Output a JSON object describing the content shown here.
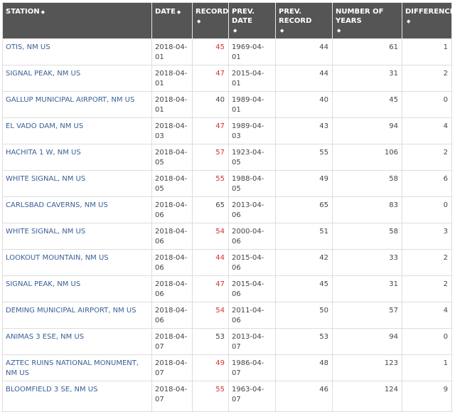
{
  "columns": [
    {
      "label": "STATION"
    },
    {
      "label": "DATE"
    },
    {
      "label": "RECORD"
    },
    {
      "label": "PREV. DATE"
    },
    {
      "label": "PREV. RECORD"
    },
    {
      "label": "NUMBER OF YEARS"
    },
    {
      "label": "DIFFERENCE"
    }
  ],
  "sort_icon": "sort-arrows-icon",
  "sort_glyph": "◆",
  "colors": {
    "header_bg": "#555555",
    "link": "#3a5f95",
    "record_hot": "#d0342c"
  },
  "rows": [
    {
      "station": "OTIS, NM US",
      "date": "2018-04-01",
      "record": "45",
      "prev_date": "1969-04-01",
      "prev_record": "44",
      "years": "61",
      "difference": "1",
      "hot": true
    },
    {
      "station": "SIGNAL PEAK, NM US",
      "date": "2018-04-01",
      "record": "47",
      "prev_date": "2015-04-01",
      "prev_record": "44",
      "years": "31",
      "difference": "2",
      "hot": true
    },
    {
      "station": "GALLUP MUNICIPAL AIRPORT, NM US",
      "date": "2018-04-01",
      "record": "40",
      "prev_date": "1989-04-01",
      "prev_record": "40",
      "years": "45",
      "difference": "0",
      "hot": false
    },
    {
      "station": "EL VADO DAM, NM US",
      "date": "2018-04-03",
      "record": "47",
      "prev_date": "1989-04-03",
      "prev_record": "43",
      "years": "94",
      "difference": "4",
      "hot": true
    },
    {
      "station": "HACHITA 1 W, NM US",
      "date": "2018-04-05",
      "record": "57",
      "prev_date": "1923-04-05",
      "prev_record": "55",
      "years": "106",
      "difference": "2",
      "hot": true
    },
    {
      "station": "WHITE SIGNAL, NM US",
      "date": "2018-04-05",
      "record": "55",
      "prev_date": "1988-04-05",
      "prev_record": "49",
      "years": "58",
      "difference": "6",
      "hot": true
    },
    {
      "station": "CARLSBAD CAVERNS, NM US",
      "date": "2018-04-06",
      "record": "65",
      "prev_date": "2013-04-06",
      "prev_record": "65",
      "years": "83",
      "difference": "0",
      "hot": false
    },
    {
      "station": "WHITE SIGNAL, NM US",
      "date": "2018-04-06",
      "record": "54",
      "prev_date": "2000-04-06",
      "prev_record": "51",
      "years": "58",
      "difference": "3",
      "hot": true
    },
    {
      "station": "LOOKOUT MOUNTAIN, NM US",
      "date": "2018-04-06",
      "record": "44",
      "prev_date": "2015-04-06",
      "prev_record": "42",
      "years": "33",
      "difference": "2",
      "hot": true
    },
    {
      "station": "SIGNAL PEAK, NM US",
      "date": "2018-04-06",
      "record": "47",
      "prev_date": "2015-04-06",
      "prev_record": "45",
      "years": "31",
      "difference": "2",
      "hot": true
    },
    {
      "station": "DEMING MUNICIPAL AIRPORT, NM US",
      "date": "2018-04-06",
      "record": "54",
      "prev_date": "2011-04-06",
      "prev_record": "50",
      "years": "57",
      "difference": "4",
      "hot": true
    },
    {
      "station": "ANIMAS 3 ESE, NM US",
      "date": "2018-04-07",
      "record": "53",
      "prev_date": "2013-04-07",
      "prev_record": "53",
      "years": "94",
      "difference": "0",
      "hot": false
    },
    {
      "station": "AZTEC RUINS NATIONAL MONUMENT, NM US",
      "date": "2018-04-07",
      "record": "49",
      "prev_date": "1986-04-07",
      "prev_record": "48",
      "years": "123",
      "difference": "1",
      "hot": true
    },
    {
      "station": "BLOOMFIELD 3 SE, NM US",
      "date": "2018-04-07",
      "record": "55",
      "prev_date": "1963-04-07",
      "prev_record": "46",
      "years": "124",
      "difference": "9",
      "hot": true
    }
  ]
}
